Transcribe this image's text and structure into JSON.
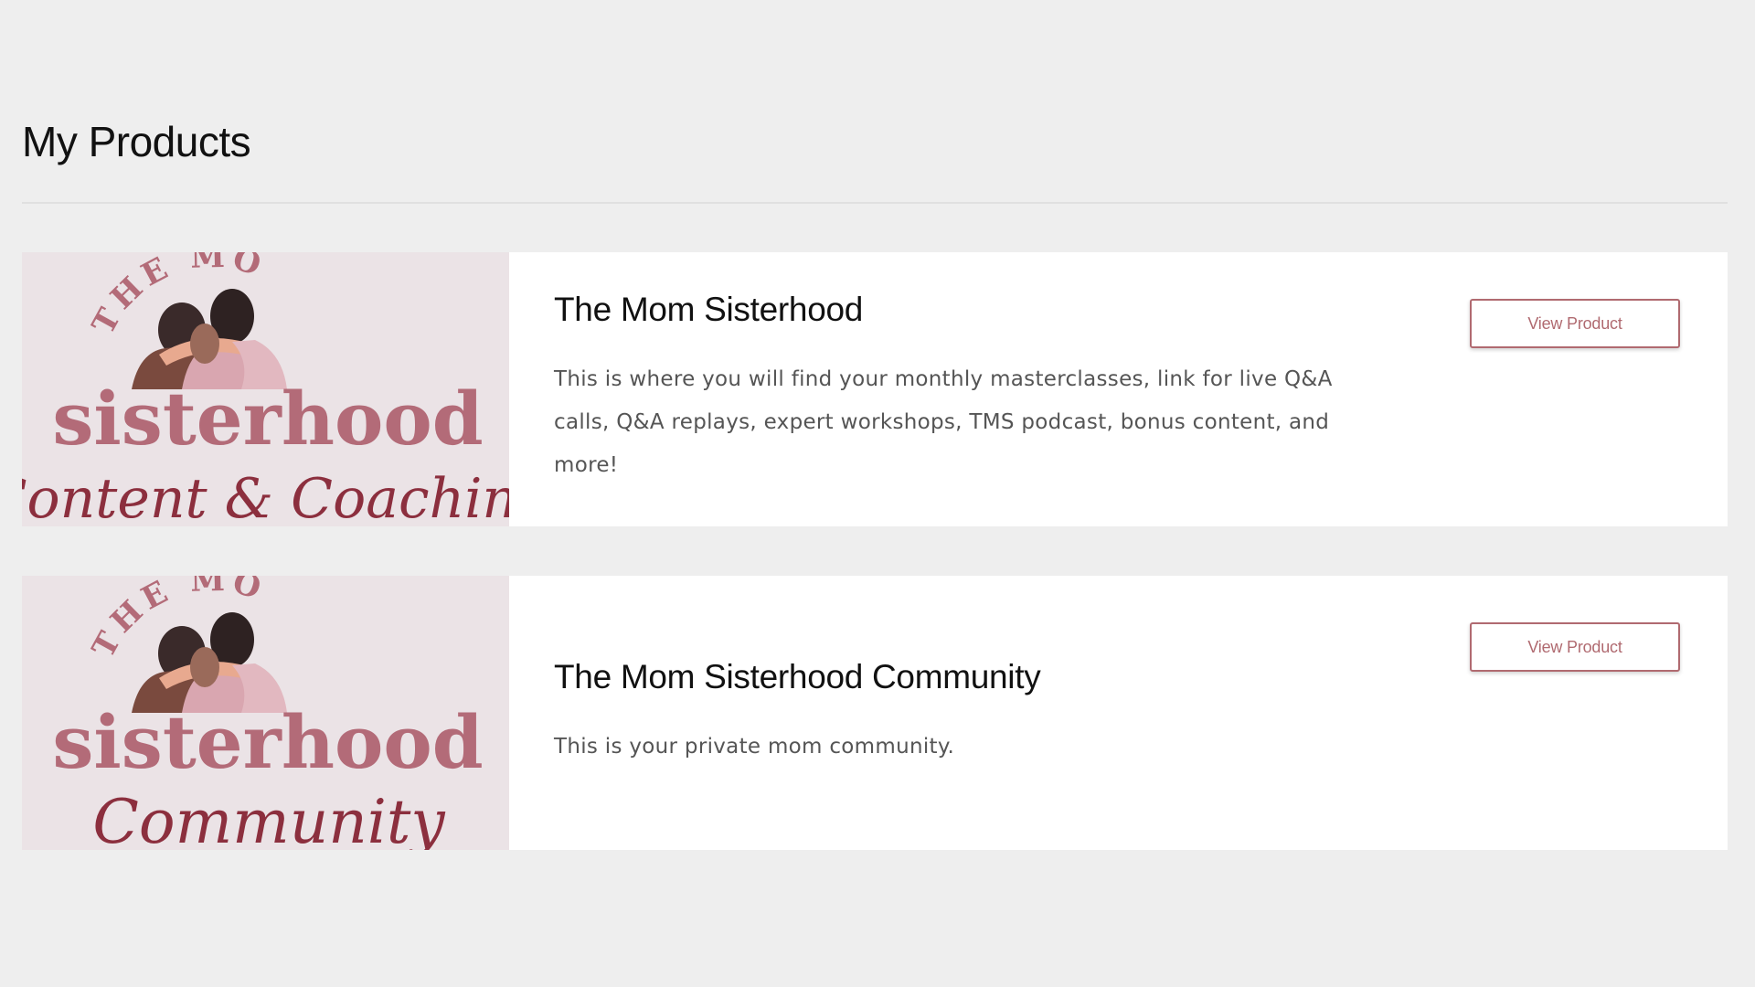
{
  "page": {
    "title": "My Products"
  },
  "colors": {
    "background": "#eeeeee",
    "card": "#ffffff",
    "thumb_bg": "#ebe3e6",
    "accent": "#b06a70",
    "logo_rose": "#b36b78",
    "logo_script": "#8c2f3e"
  },
  "products": [
    {
      "title": "The Mom Sisterhood",
      "description": "This is where you will find your monthly masterclasses, link for live Q&A calls, Q&A replays, expert workshops, TMS podcast, bonus content, and more!",
      "button_label": "View Product",
      "logo": {
        "top_text": "THE MOM",
        "main_text": "sisterhood",
        "script_text": "Content & Coaching"
      }
    },
    {
      "title": "The Mom Sisterhood Community",
      "description": "This is your private mom community.",
      "button_label": "View Product",
      "logo": {
        "top_text": "THE MOM",
        "main_text": "sisterhood",
        "script_text": "Community"
      }
    }
  ]
}
